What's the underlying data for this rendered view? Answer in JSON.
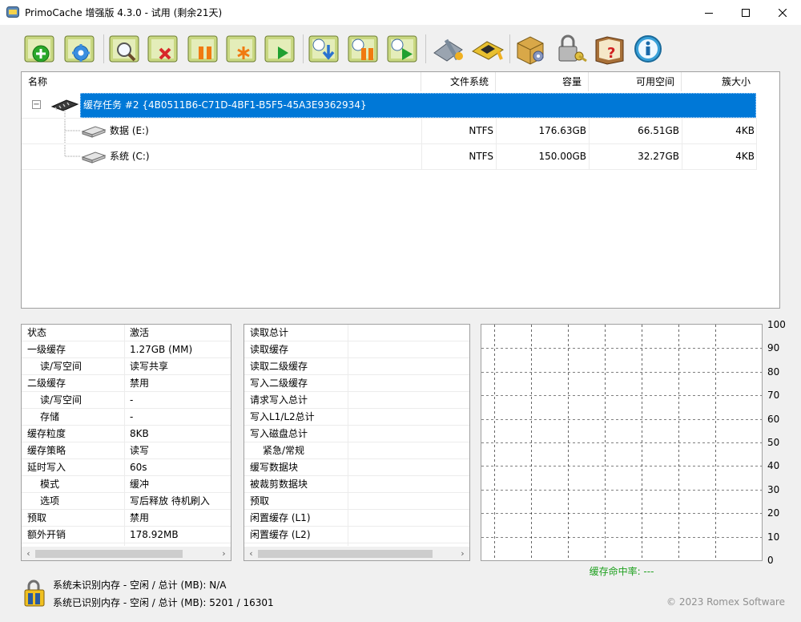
{
  "window": {
    "title": "PrimoCache 增强版 4.3.0 - 试用 (剩余21天)"
  },
  "toolbar": {
    "buttons": [
      {
        "name": "new-cache-task-button"
      },
      {
        "name": "cache-settings-button"
      },
      {
        "name": "cache-statistics-button"
      },
      {
        "name": "delete-cache-task-button"
      },
      {
        "name": "pause-cache-button"
      },
      {
        "name": "flush-cache-button"
      },
      {
        "name": "resume-cache-button"
      },
      {
        "name": "load-cache-button"
      },
      {
        "name": "pause-prefetch-button"
      },
      {
        "name": "resume-prefetch-button"
      },
      {
        "name": "tools-button"
      },
      {
        "name": "memory-button"
      },
      {
        "name": "options-button"
      },
      {
        "name": "license-button"
      },
      {
        "name": "help-button"
      },
      {
        "name": "about-button"
      }
    ]
  },
  "tree": {
    "columns": [
      "名称",
      "文件系统",
      "容量",
      "可用空间",
      "簇大小"
    ],
    "expander": "−",
    "task_label": "缓存任务 #2 {4B0511B6-C71D-4BF1-B5F5-45A3E9362934}",
    "volumes": [
      {
        "name": "数据 (E:)",
        "fs": "NTFS",
        "capacity": "176.63GB",
        "free": "66.51GB",
        "cluster": "4KB"
      },
      {
        "name": "系统 (C:)",
        "fs": "NTFS",
        "capacity": "150.00GB",
        "free": "32.27GB",
        "cluster": "4KB"
      }
    ]
  },
  "props": [
    {
      "key": "状态",
      "value": "激活",
      "indent": false
    },
    {
      "key": "一级缓存",
      "value": "1.27GB (MM)",
      "indent": false
    },
    {
      "key": "读/写空间",
      "value": "读写共享",
      "indent": true
    },
    {
      "key": "二级缓存",
      "value": "禁用",
      "indent": false
    },
    {
      "key": "读/写空间",
      "value": "-",
      "indent": true
    },
    {
      "key": "存储",
      "value": "-",
      "indent": true
    },
    {
      "key": "缓存粒度",
      "value": "8KB",
      "indent": false
    },
    {
      "key": "缓存策略",
      "value": "读写",
      "indent": false
    },
    {
      "key": "延时写入",
      "value": "60s",
      "indent": false
    },
    {
      "key": "模式",
      "value": "缓冲",
      "indent": true
    },
    {
      "key": "选项",
      "value": "写后释放 待机刷入",
      "indent": true
    },
    {
      "key": "预取",
      "value": "禁用",
      "indent": false
    },
    {
      "key": "额外开销",
      "value": "178.92MB",
      "indent": false
    }
  ],
  "stats": [
    {
      "key": "读取总计",
      "indent": false
    },
    {
      "key": "读取缓存",
      "indent": false
    },
    {
      "key": "读取二级缓存",
      "indent": false
    },
    {
      "key": "写入二级缓存",
      "indent": false
    },
    {
      "key": "请求写入总计",
      "indent": false
    },
    {
      "key": "写入L1/L2总计",
      "indent": false
    },
    {
      "key": "写入磁盘总计",
      "indent": false
    },
    {
      "key": "紧急/常规",
      "indent": true
    },
    {
      "key": "缓写数据块",
      "indent": false
    },
    {
      "key": "被裁剪数据块",
      "indent": false
    },
    {
      "key": "预取",
      "indent": false
    },
    {
      "key": "闲置缓存 (L1)",
      "indent": false
    },
    {
      "key": "闲置缓存 (L2)",
      "indent": false
    }
  ],
  "scroll": {
    "left": "‹",
    "right": "›"
  },
  "chart": {
    "y_ticks": [
      "100",
      "90",
      "80",
      "70",
      "60",
      "50",
      "40",
      "30",
      "20",
      "10",
      "0"
    ],
    "hit_rate_label": "缓存命中率: ---",
    "grid_color": "#000000",
    "hit_color": "#1ea01e"
  },
  "status": {
    "line1": "系统未识别内存 - 空闲 / 总计 (MB):   N/A",
    "line2": "系统已识别内存 - 空闲 / 总计 (MB):   5201 / 16301",
    "copyright": "© 2023 Romex Software"
  },
  "colors": {
    "selection": "#0078d7"
  }
}
